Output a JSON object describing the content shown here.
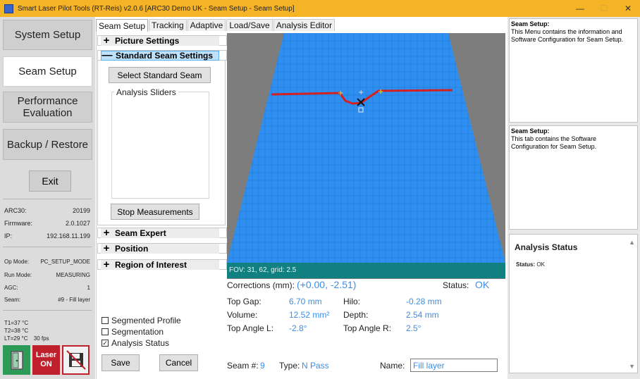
{
  "titlebar": {
    "title": "Smart Laser Pilot Tools (RT-Reis) v2.0.6 [ARC30 Demo UK - Seam Setup - Seam Setup]",
    "minimize": "—",
    "maximize": "☐",
    "close": "✕"
  },
  "nav": {
    "system_setup": "System Setup",
    "seam_setup": "Seam Setup",
    "performance_eval_1": "Performance",
    "performance_eval_2": "Evaluation",
    "backup_restore": "Backup / Restore",
    "exit": "Exit"
  },
  "device": {
    "arc30_label": "ARC30:",
    "arc30_value": "20199",
    "firmware_label": "Firmware:",
    "firmware_value": "2.0.1027",
    "ip_label": "IP:",
    "ip_value": "192.168.11.199",
    "opmode_label": "Op Mode:",
    "opmode_value": "PC_SETUP_MODE",
    "runmode_label": "Run Mode:",
    "runmode_value": "MEASURING",
    "agc_label": "AGC:",
    "agc_value": "1",
    "seam_label": "Seam:",
    "seam_value": "#9 - Fill layer",
    "t1": "T1=37 °C",
    "t2": "T2=38 °C",
    "lt": "LT=29 °C",
    "fps": "30 fps"
  },
  "bottom_icons": {
    "laser_1": "Laser",
    "laser_2": "ON"
  },
  "tabs": [
    "Seam Setup",
    "Tracking",
    "Adaptive",
    "Load/Save",
    "Analysis Editor"
  ],
  "sections": {
    "picture_settings": "Picture Settings",
    "standard_seam_settings": "Standard Seam Settings",
    "seam_expert": "Seam Expert",
    "position": "Position",
    "region_of_interest": "Region of Interest",
    "plus": "+",
    "minus": "—"
  },
  "seam_controls": {
    "select_standard_seam": "Select Standard Seam",
    "analysis_sliders": "Analysis Sliders",
    "stop_measurements": "Stop Measurements"
  },
  "options": {
    "segmented_profile": "Segmented Profile",
    "segmentation": "Segmentation",
    "analysis_status": "Analysis Status",
    "segmented_profile_checked": false,
    "segmentation_checked": false,
    "analysis_status_checked": true,
    "check_mark": "☑"
  },
  "buttons": {
    "save": "Save",
    "cancel": "Cancel"
  },
  "camera": {
    "fov": "FOV: 31, 62, grid: 2.5",
    "background": "#7d7d7d",
    "grid_color": "#2f8ff0",
    "laser_color": "#d42020"
  },
  "measurements": {
    "corrections_label": "Corrections (mm):",
    "corrections_value": "(+0.00, -2.51)",
    "status_label": "Status:",
    "status_value": "OK",
    "top_gap_label": "Top Gap:",
    "top_gap_value": "6.70 mm",
    "hilo_label": "Hilo:",
    "hilo_value": "-0.28 mm",
    "volume_label": "Volume:",
    "volume_value": "12.52 mm²",
    "depth_label": "Depth:",
    "depth_value": "2.54 mm",
    "top_angle_l_label": "Top Angle L:",
    "top_angle_l_value": "-2.8°",
    "top_angle_r_label": "Top Angle R:",
    "top_angle_r_value": "2.5°",
    "seam_num_label": "Seam #:",
    "seam_num_value": "9",
    "type_label": "Type:",
    "type_value": "N Pass",
    "name_label": "Name:",
    "name_value": "Fill layer"
  },
  "help": {
    "box1_title": "Seam Setup:",
    "box1_text": "This Menu contains the information and Software Configuration for Seam Setup.",
    "box2_title": "Seam Setup:",
    "box2_text": "This tab contains the Software Configuration for Seam Setup."
  },
  "analysis_status_panel": {
    "title": "Analysis Status",
    "status_label": "Status:",
    "status_value": "OK",
    "scroll_up": "▲",
    "scroll_down": "▼"
  },
  "colors": {
    "titlebar": "#f5b326",
    "accent_value": "#3c8ee8",
    "laser_button": "#c0202c",
    "fov_bar": "#108080"
  }
}
